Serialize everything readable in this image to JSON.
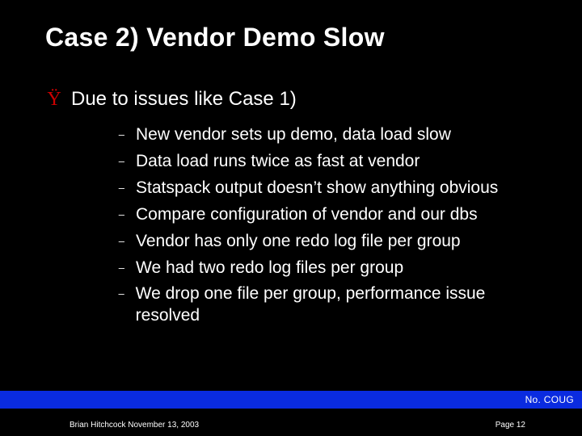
{
  "title": "Case 2) Vendor Demo Slow",
  "lead": {
    "bullet": "Ÿ",
    "text": "Due to issues like Case 1)"
  },
  "sub_items": [
    "New vendor sets up demo, data load slow",
    "Data load runs twice as fast at vendor",
    "Statspack output doesn’t show anything obvious",
    "Compare configuration of vendor and our dbs",
    "Vendor has only one redo log file per group",
    "We had two redo log files per group",
    "We drop one file per group, performance issue resolved"
  ],
  "footer": {
    "brand": "No. COUG",
    "author_date": "Brian Hitchcock  November 13, 2003",
    "page": "Page 12"
  }
}
